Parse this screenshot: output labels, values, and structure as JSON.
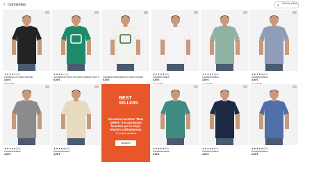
{
  "header": {
    "back_icon": "chevron-left-icon",
    "title": "Camisetas",
    "filter_icon": "sliders-icon",
    "filter_label": "Ordenar y filtrar"
  },
  "colors": {
    "promo_background": "#e8572a",
    "badge_text": "#ffffff",
    "favorite_badge": "#c8c8c8"
  },
  "products": [
    {
      "stars": "★★★★★",
      "reviews": "(12)",
      "name": "Camiseta con cuello redondo",
      "price": "4,00 €",
      "extra": "Extra Slim",
      "extra_link": false,
      "shirt_color": "#232323",
      "has_print": false,
      "print_color": ""
    },
    {
      "stars": "★★★★☆",
      "reviews": "(4)",
      "name": "Camiseta de punto con cuello redondo 'New York'",
      "price": "6,00 €",
      "extra": "",
      "extra_link": false,
      "shirt_color": "#1f8a6a",
      "has_print": true,
      "print_color": "#ffffff"
    },
    {
      "stars": "",
      "reviews": "",
      "name": "Camiseta estampada con cuello redondo",
      "price": "6,00 €",
      "extra": "",
      "extra_link": false,
      "shirt_color": "#f2f2ee",
      "has_print": true,
      "print_color": "#3a6a3a"
    },
    {
      "stars": "★★★★★",
      "reviews": "(60)",
      "name": "Camiseta básica",
      "price": "4,00 €",
      "extra": "11 Colores",
      "extra_link": true,
      "shirt_color": "#f5f5f5",
      "has_print": false,
      "print_color": ""
    },
    {
      "stars": "★★★★★",
      "reviews": "(60)",
      "name": "Camiseta básica",
      "price": "4,00 €",
      "extra": "11 Colores",
      "extra_link": true,
      "shirt_color": "#8fb3a4",
      "has_print": false,
      "print_color": ""
    },
    {
      "stars": "★★★★★",
      "reviews": "(60)",
      "name": "Camiseta básica",
      "price": "4,00 €",
      "extra": "11 Colores",
      "extra_link": true,
      "shirt_color": "#8f9db8",
      "has_print": false,
      "print_color": ""
    },
    {
      "stars": "★★★★★",
      "reviews": "(60)",
      "name": "Camiseta básica",
      "price": "4,00 €",
      "extra": "",
      "extra_link": false,
      "shirt_color": "#8b8b8b",
      "has_print": false,
      "print_color": ""
    },
    {
      "stars": "★★★★★",
      "reviews": "(60)",
      "name": "Camiseta básica",
      "price": "4,00 €",
      "extra": "",
      "extra_link": false,
      "shirt_color": "#e7dcc0",
      "has_print": false,
      "print_color": ""
    },
    {
      "stars": "★★★★★",
      "reviews": "(60)",
      "name": "Camiseta básica",
      "price": "4,00 €",
      "extra": "",
      "extra_link": false,
      "shirt_color": "#3f8c83",
      "has_print": false,
      "print_color": ""
    },
    {
      "stars": "★★★★★",
      "reviews": "(60)",
      "name": "Camiseta básica",
      "price": "4,00 €",
      "extra": "",
      "extra_link": false,
      "shirt_color": "#1d2a44",
      "has_print": false,
      "print_color": ""
    },
    {
      "stars": "★★★★★",
      "reviews": "(60)",
      "name": "Camiseta básica",
      "price": "4,00 €",
      "extra": "",
      "extra_link": false,
      "shirt_color": "#4f6fa8",
      "has_print": false,
      "print_color": ""
    }
  ],
  "promo": {
    "badge_line1": "BEST",
    "badge_line2": "SELLERS",
    "text": "Descubre nuestros \"Best Sellers\", los productos favoritos por la mejor relación calidad/precio.",
    "subtext": "Tu compra confianza",
    "button_label": "Descubrir"
  }
}
